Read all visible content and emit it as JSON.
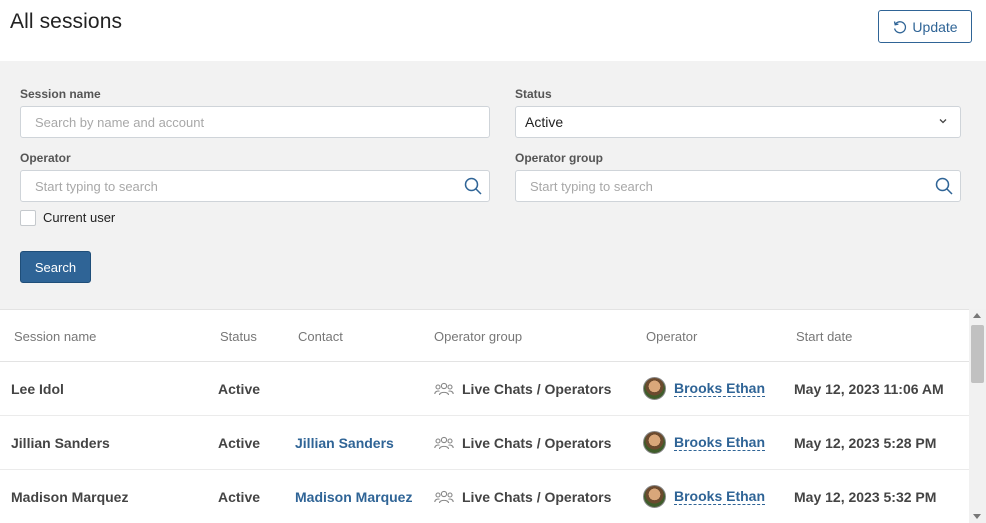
{
  "page": {
    "title": "All sessions",
    "update_label": "Update"
  },
  "filters": {
    "session_name_label": "Session name",
    "session_name_placeholder": "Search by name and account",
    "status_label": "Status",
    "status_value": "Active",
    "operator_label": "Operator",
    "operator_placeholder": "Start typing to search",
    "operator_group_label": "Operator group",
    "operator_group_placeholder": "Start typing to search",
    "current_user_label": "Current user",
    "current_user_checked": false,
    "search_label": "Search"
  },
  "table": {
    "columns": [
      "Session name",
      "Status",
      "Contact",
      "Operator group",
      "Operator",
      "Start date"
    ],
    "rows": [
      {
        "session_name": "Lee Idol",
        "status": "Active",
        "contact": "",
        "operator_group": "Live Chats / Operators",
        "operator": "Brooks Ethan",
        "start_date": "May 12, 2023 11:06 AM"
      },
      {
        "session_name": "Jillian Sanders",
        "status": "Active",
        "contact": "Jillian Sanders",
        "operator_group": "Live Chats / Operators",
        "operator": "Brooks Ethan",
        "start_date": "May 12, 2023 5:28 PM"
      },
      {
        "session_name": "Madison Marquez",
        "status": "Active",
        "contact": "Madison Marquez",
        "operator_group": "Live Chats / Operators",
        "operator": "Brooks Ethan",
        "start_date": "May 12, 2023 5:32 PM"
      }
    ]
  },
  "colors": {
    "accent": "#2f6496",
    "panel_bg": "#f2f2f2"
  }
}
